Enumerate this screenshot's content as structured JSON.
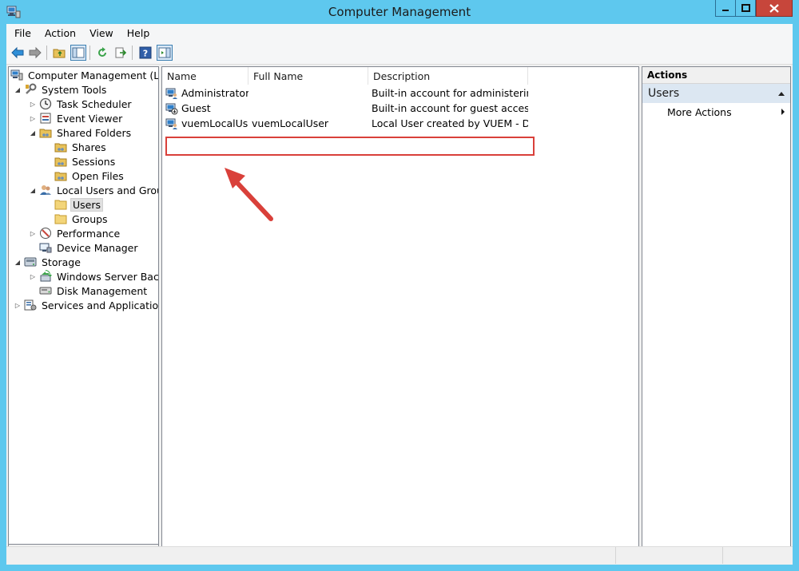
{
  "window": {
    "title": "Computer Management",
    "icon": "computer-management-icon",
    "accent_color": "#5ec8ee",
    "close_color": "#c7463b"
  },
  "menu": [
    "File",
    "Action",
    "View",
    "Help"
  ],
  "toolbar": {
    "icons": [
      "back-arrow-icon",
      "forward-arrow-icon",
      "up-folder-icon",
      "show-hide-console-tree-icon",
      "refresh-icon",
      "export-list-icon",
      "help-icon",
      "show-hide-action-pane-icon"
    ]
  },
  "tree": {
    "root": "Computer Management (Local",
    "system_tools": "System Tools",
    "task_scheduler": "Task Scheduler",
    "event_viewer": "Event Viewer",
    "shared_folders": "Shared Folders",
    "shares": "Shares",
    "sessions": "Sessions",
    "open_files": "Open Files",
    "local_users": "Local Users and Groups",
    "users": "Users",
    "groups": "Groups",
    "performance": "Performance",
    "device_manager": "Device Manager",
    "storage": "Storage",
    "windows_backup": "Windows Server Backup",
    "disk_management": "Disk Management",
    "services": "Services and Applications"
  },
  "list": {
    "columns": [
      "Name",
      "Full Name",
      "Description"
    ],
    "rows": [
      {
        "name": "Administrator",
        "full_name": "",
        "description": "Built-in account for administering..."
      },
      {
        "name": "Guest",
        "full_name": "",
        "description": "Built-in account for guest access t..."
      },
      {
        "name": "vuemLocalUser",
        "full_name": "vuemLocalUser",
        "description": "Local User created by VUEM - Do ..."
      }
    ],
    "highlight_color": "#d9403a"
  },
  "actions": {
    "header": "Actions",
    "section": "Users",
    "item": "More Actions"
  }
}
